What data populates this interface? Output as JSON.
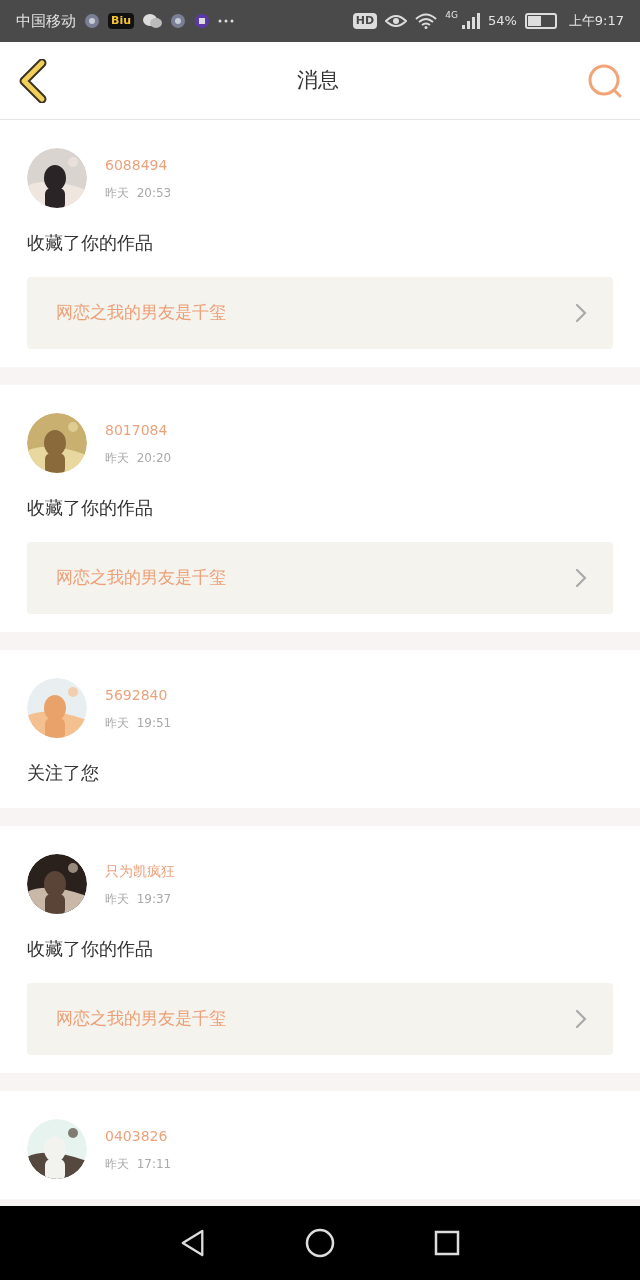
{
  "status_bar": {
    "carrier": "中国移动",
    "app_badge": "Biu",
    "hd": "HD",
    "network": "4G",
    "battery": "54%",
    "time": "上午9:17"
  },
  "header": {
    "title": "消息"
  },
  "messages": [
    {
      "name": "6088494",
      "time": "昨天  20:53",
      "action": "收藏了你的作品",
      "work": "网恋之我的男友是千玺"
    },
    {
      "name": "8017084",
      "time": "昨天  20:20",
      "action": "收藏了你的作品",
      "work": "网恋之我的男友是千玺"
    },
    {
      "name": "5692840",
      "time": "昨天  19:51",
      "action": "关注了您"
    },
    {
      "name": "只为凯疯狂",
      "time": "昨天  19:37",
      "action": "收藏了你的作品",
      "work": "网恋之我的男友是千玺"
    },
    {
      "name": "0403826",
      "time": "昨天  17:11"
    }
  ]
}
